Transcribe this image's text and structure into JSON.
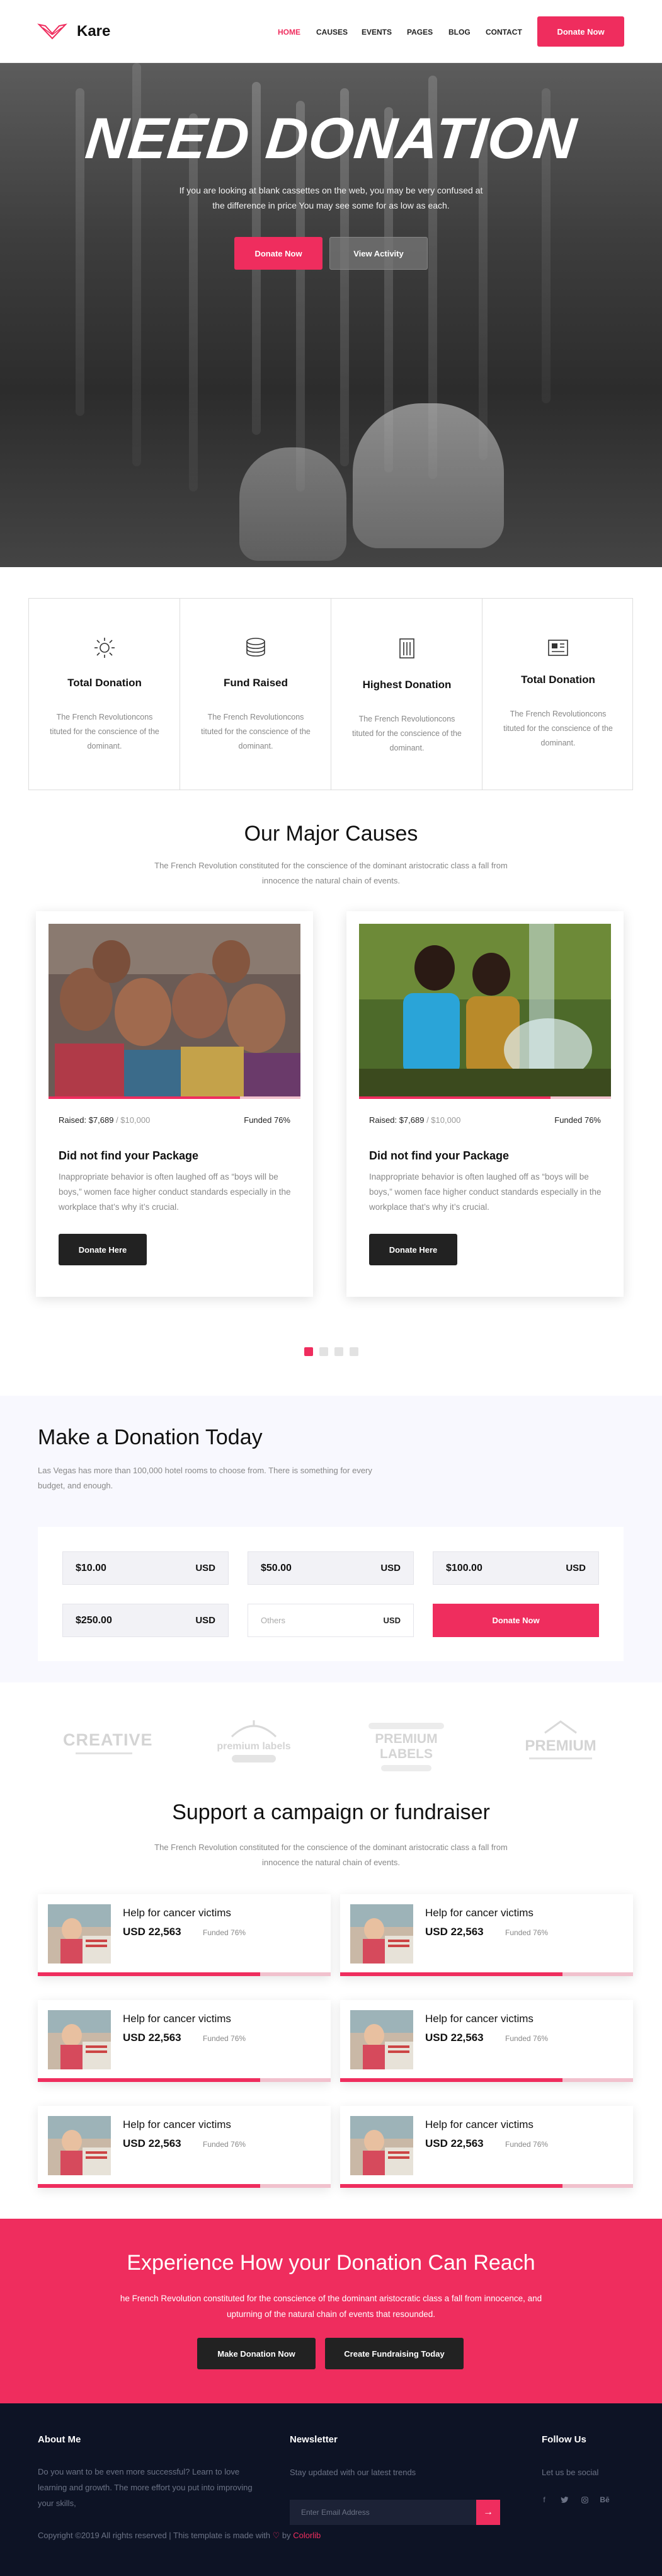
{
  "header": {
    "logo": "Kare",
    "nav": [
      "HOME",
      "CAUSES",
      "EVENTS",
      "PAGES",
      "BLOG",
      "CONTACT"
    ],
    "cta": "Donate Now",
    "accent": "#ef2d5e"
  },
  "hero": {
    "title": "NEED DONATION",
    "text": "If you are looking at blank cassettes on the web, you may be very confused at the difference in price You may see some for as low as each.",
    "btn_primary": "Donate Now",
    "btn_secondary": "View Activity"
  },
  "features": [
    {
      "icon": "sun-icon",
      "title": "Total Donation",
      "desc": "The French Revolutioncons tituted for the conscience of the dominant."
    },
    {
      "icon": "coin-stack-icon",
      "title": "Fund Raised",
      "desc": "The French Revolutioncons tituted for the conscience of the dominant."
    },
    {
      "icon": "building-icon",
      "title": "Highest Donation",
      "desc": "The French Revolutioncons tituted for the conscience of the dominant."
    },
    {
      "icon": "newspaper-icon",
      "title": "Total Donation",
      "desc": "The French Revolutioncons tituted for the conscience of the dominant."
    }
  ],
  "causes": {
    "title": "Our Major Causes",
    "subtitle": "The French Revolution constituted for the conscience of the dominant aristocratic class a fall from innocence the natural chain of events.",
    "cards": [
      {
        "raised": "Raised: $7,689",
        "goal": "/ $10,000",
        "funded": "Funded 76%",
        "progress": 0.76,
        "title": "Did not find your Package",
        "desc": "Inappropriate behavior is often laughed off as “boys will be boys,” women face higher conduct standards especially in the workplace that’s why it’s crucial.",
        "button": "Donate Here"
      },
      {
        "raised": "Raised: $7,689",
        "goal": "/ $10,000",
        "funded": "Funded 76%",
        "progress": 0.76,
        "title": "Did not find your Package",
        "desc": "Inappropriate behavior is often laughed off as “boys will be boys,” women face higher conduct standards especially in the workplace that’s why it’s crucial.",
        "button": "Donate Here"
      }
    ],
    "slides": 4,
    "active_slide": 1
  },
  "donation": {
    "title": "Make a Donation Today",
    "subtitle": "Las Vegas has more than 100,000 hotel rooms to choose from. There is something for every budget, and enough.",
    "amounts": [
      {
        "value": "$10.00",
        "currency": "USD"
      },
      {
        "value": "$50.00",
        "currency": "USD"
      },
      {
        "value": "$100.00",
        "currency": "USD"
      },
      {
        "value": "$250.00",
        "currency": "USD"
      }
    ],
    "others_placeholder": "Others",
    "others_currency": "USD",
    "button": "Donate Now"
  },
  "brands": [
    "CREATIVE",
    "premium labels",
    "PREMIUM LABELS",
    "PREMIUM"
  ],
  "fundraiser": {
    "title": "Support a campaign or fundraiser",
    "subtitle": "The French Revolution constituted for the conscience of the dominant aristocratic class a fall from innocence the natural chain of events.",
    "cards": [
      {
        "title": "Help for cancer victims",
        "amount": "USD 22,563",
        "funded": "Funded 76%",
        "progress": 0.76
      },
      {
        "title": "Help for cancer victims",
        "amount": "USD 22,563",
        "funded": "Funded 76%",
        "progress": 0.76
      },
      {
        "title": "Help for cancer victims",
        "amount": "USD 22,563",
        "funded": "Funded 76%",
        "progress": 0.76
      },
      {
        "title": "Help for cancer victims",
        "amount": "USD 22,563",
        "funded": "Funded 76%",
        "progress": 0.76
      },
      {
        "title": "Help for cancer victims",
        "amount": "USD 22,563",
        "funded": "Funded 76%",
        "progress": 0.76
      },
      {
        "title": "Help for cancer victims",
        "amount": "USD 22,563",
        "funded": "Funded 76%",
        "progress": 0.76
      }
    ]
  },
  "cta": {
    "title": "Experience How your Donation Can Reach",
    "text": "he French Revolution constituted for the conscience of the dominant aristocratic class a fall from innocence, and upturning of the natural chain of events that resounded.",
    "btn1": "Make Donation Now",
    "btn2": "Create Fundraising Today"
  },
  "footer": {
    "about_title": "About Me",
    "about_text": "Do you want to be even more successful? Learn to love learning and growth. The more effort you put into improving your skills,",
    "newsletter_title": "Newsletter",
    "newsletter_text": "Stay updated with our latest trends",
    "newsletter_placeholder": "Enter Email Address",
    "follow_title": "Follow Us",
    "follow_text": "Let us be social",
    "social": [
      "facebook-icon",
      "twitter-icon",
      "instagram-icon",
      "behance-icon"
    ],
    "copyright_prefix": "Copyright ©2019 All rights reserved | This template is made with",
    "copyright_by": "by",
    "copyright_brand": "Colorlib"
  }
}
